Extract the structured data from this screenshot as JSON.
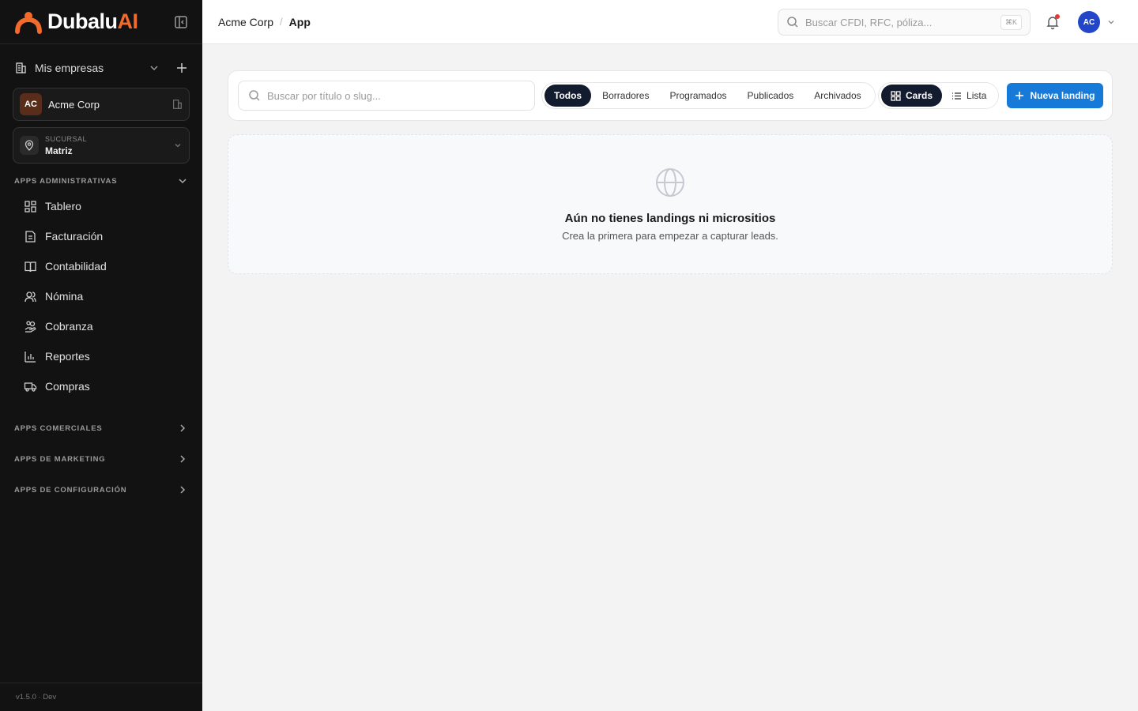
{
  "brand": {
    "name_main": "Dubalu",
    "name_accent": "AI"
  },
  "sidebar": {
    "my_companies_label": "Mis empresas",
    "company": {
      "initials": "AC",
      "name": "Acme Corp"
    },
    "branch": {
      "label": "SUCURSAL",
      "value": "Matriz"
    },
    "groups": [
      {
        "label": "APPS ADMINISTRATIVAS"
      },
      {
        "label": "APPS COMERCIALES"
      },
      {
        "label": "APPS DE MARKETING"
      },
      {
        "label": "APPS DE CONFIGURACIÓN"
      }
    ],
    "items": [
      {
        "label": "Tablero",
        "icon": "dashboard-icon"
      },
      {
        "label": "Facturación",
        "icon": "invoice-icon"
      },
      {
        "label": "Contabilidad",
        "icon": "book-icon"
      },
      {
        "label": "Nómina",
        "icon": "users-icon"
      },
      {
        "label": "Cobranza",
        "icon": "hand-coins-icon"
      },
      {
        "label": "Reportes",
        "icon": "bar-chart-icon"
      },
      {
        "label": "Compras",
        "icon": "truck-icon"
      }
    ],
    "version": "v1.5.0 · Dev"
  },
  "topbar": {
    "breadcrumb": [
      "Acme Corp",
      "App"
    ],
    "breadcrumb_sep": "/",
    "search_placeholder": "Buscar CFDI, RFC, póliza...",
    "shortcut": "⌘K",
    "user_initials": "AC"
  },
  "main": {
    "search_placeholder": "Buscar por título o slug...",
    "filters": [
      "Todos",
      "Borradores",
      "Programados",
      "Publicados",
      "Archivados"
    ],
    "active_filter": "Todos",
    "views": [
      "Cards",
      "Lista"
    ],
    "active_view": "Cards",
    "new_button": "Nueva landing",
    "empty": {
      "title": "Aún no tienes landings ni micrositios",
      "subtitle": "Crea la primera para empezar a capturar leads."
    }
  },
  "colors": {
    "accent": "#f26b2a",
    "primary": "#1779d8",
    "dark_pill": "#131b2e",
    "sidebar_bg": "#121212"
  }
}
